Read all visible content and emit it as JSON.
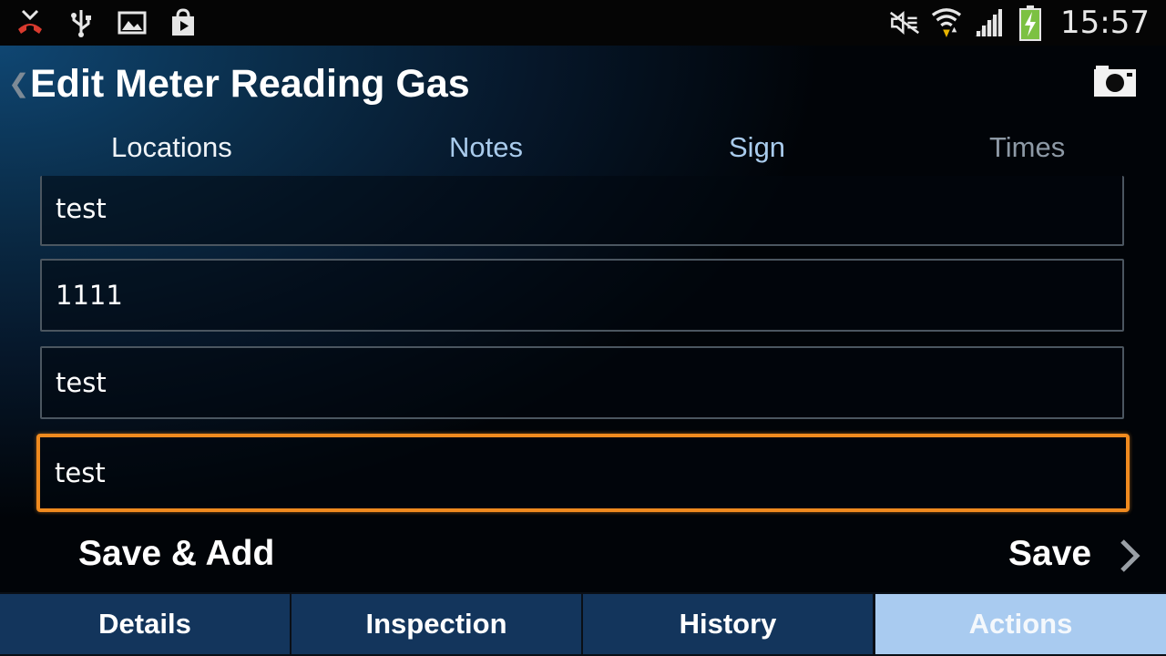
{
  "status_bar": {
    "time": "15:57",
    "left_icons": [
      "missed-call-icon",
      "usb-icon",
      "image-icon",
      "play-store-icon"
    ],
    "right_icons": [
      "mute-icon",
      "wifi-icon",
      "signal-icon",
      "battery-charging-icon"
    ]
  },
  "header": {
    "title": "Edit Meter Reading Gas"
  },
  "tabs": [
    {
      "label": "Locations"
    },
    {
      "label": "Notes"
    },
    {
      "label": "Sign"
    },
    {
      "label": "Times"
    }
  ],
  "fields": [
    {
      "value": "test"
    },
    {
      "value": "1111"
    },
    {
      "value": "test"
    },
    {
      "value": "test"
    }
  ],
  "actions": {
    "save_add_label": "Save & Add",
    "save_label": "Save"
  },
  "bottom_nav": [
    {
      "label": "Details"
    },
    {
      "label": "Inspection"
    },
    {
      "label": "History"
    },
    {
      "label": "Actions"
    }
  ],
  "colors": {
    "focus_border": "#ef8a1f",
    "nav_tab": "#13355c",
    "nav_tab_selected": "#a9cbf0",
    "tab_link": "#a9cbec"
  }
}
